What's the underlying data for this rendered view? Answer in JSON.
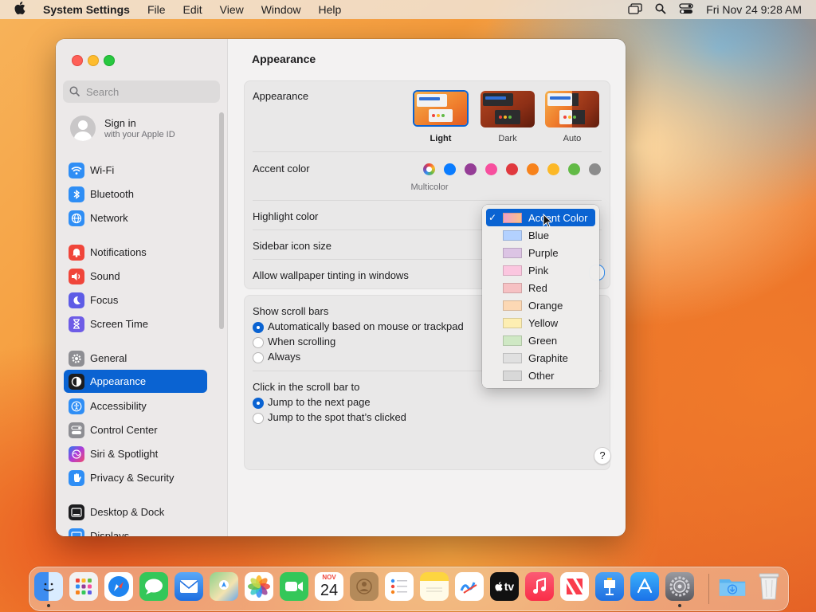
{
  "menubar": {
    "app_name": "System Settings",
    "items": [
      "File",
      "Edit",
      "View",
      "Window",
      "Help"
    ],
    "datetime": "Fri Nov 24  9:28 AM"
  },
  "sidebar": {
    "search_placeholder": "Search",
    "signin": {
      "title": "Sign in",
      "subtitle": "with your Apple ID"
    },
    "items": [
      {
        "label": "Wi-Fi",
        "icon": "wifi-icon",
        "color": "#2f8ef5"
      },
      {
        "label": "Bluetooth",
        "icon": "bluetooth-icon",
        "color": "#2f8ef5"
      },
      {
        "label": "Network",
        "icon": "globe-icon",
        "color": "#2f8ef5"
      },
      {
        "label": "Notifications",
        "icon": "bell-icon",
        "color": "#f0453a"
      },
      {
        "label": "Sound",
        "icon": "speaker-icon",
        "color": "#f0453a"
      },
      {
        "label": "Focus",
        "icon": "moon-icon",
        "color": "#5e5ce6"
      },
      {
        "label": "Screen Time",
        "icon": "hourglass-icon",
        "color": "#6e5ce6"
      },
      {
        "label": "General",
        "icon": "gear-icon",
        "color": "#8e8e93"
      },
      {
        "label": "Appearance",
        "icon": "appearance-icon",
        "color": "#1d1d1f"
      },
      {
        "label": "Accessibility",
        "icon": "accessibility-icon",
        "color": "#2f8ef5"
      },
      {
        "label": "Control Center",
        "icon": "control-center-icon",
        "color": "#8e8e93"
      },
      {
        "label": "Siri & Spotlight",
        "icon": "siri-icon",
        "color": "#7f3fbf"
      },
      {
        "label": "Privacy & Security",
        "icon": "hand-icon",
        "color": "#2f8ef5"
      },
      {
        "label": "Desktop & Dock",
        "icon": "dock-icon",
        "color": "#1d1d1f"
      },
      {
        "label": "Displays",
        "icon": "display-icon",
        "color": "#2f8ef5"
      }
    ]
  },
  "content": {
    "title": "Appearance",
    "appearance_label": "Appearance",
    "modes": [
      "Light",
      "Dark",
      "Auto"
    ],
    "accent_label": "Accent color",
    "accent_selected_name": "Multicolor",
    "accent_colors": [
      "#0a7cff",
      "#953d96",
      "#f74f9e",
      "#e0383e",
      "#f7821b",
      "#fcb827",
      "#62ba46",
      "#8c8c8c"
    ],
    "highlight_label": "Highlight color",
    "sidebar_icon_label": "Sidebar icon size",
    "tinting_label": "Allow wallpaper tinting in windows",
    "scroll_label": "Show scroll bars",
    "scroll_options": [
      "Automatically based on mouse or trackpad",
      "When scrolling",
      "Always"
    ],
    "click_label": "Click in the scroll bar to",
    "click_options": [
      "Jump to the next page",
      "Jump to the spot that’s clicked"
    ],
    "help": "?"
  },
  "highlight_menu": {
    "items": [
      {
        "label": "Accent Color",
        "swatch": "#e9a0c0",
        "selected": true
      },
      {
        "label": "Blue",
        "swatch": "#b3d1ff"
      },
      {
        "label": "Purple",
        "swatch": "#dcc4e4"
      },
      {
        "label": "Pink",
        "swatch": "#fbc6df"
      },
      {
        "label": "Red",
        "swatch": "#f6c1c3"
      },
      {
        "label": "Orange",
        "swatch": "#fcd8b4"
      },
      {
        "label": "Yellow",
        "swatch": "#fdeeb2"
      },
      {
        "label": "Green",
        "swatch": "#cfe8c4"
      },
      {
        "label": "Graphite",
        "swatch": "#e0e0e0"
      },
      {
        "label": "Other",
        "swatch": "#d8d8d8"
      }
    ]
  },
  "dock": {
    "calendar_month": "NOV",
    "calendar_day": "24",
    "tv_label": "tv",
    "apps": [
      {
        "name": "finder-icon",
        "color": "#3d8cf0"
      },
      {
        "name": "launchpad-icon",
        "color": "#f2f2f2"
      },
      {
        "name": "safari-icon",
        "color": "#1e84f0"
      },
      {
        "name": "messages-icon",
        "color": "#34c759"
      },
      {
        "name": "mail-icon",
        "color": "#3b8df5"
      },
      {
        "name": "maps-icon",
        "color": "#5fbf6a"
      },
      {
        "name": "photos-icon",
        "color": "#f8f8f8"
      },
      {
        "name": "facetime-icon",
        "color": "#34c759"
      },
      {
        "name": "calendar-icon",
        "color": "#ffffff"
      },
      {
        "name": "contacts-icon",
        "color": "#b48a5a"
      },
      {
        "name": "reminders-icon",
        "color": "#ffffff"
      },
      {
        "name": "notes-icon",
        "color": "#fdd540"
      },
      {
        "name": "freeform-icon",
        "color": "#ffffff"
      },
      {
        "name": "apple-tv-icon",
        "color": "#111111"
      },
      {
        "name": "music-icon",
        "color": "#fa3c4c"
      },
      {
        "name": "news-icon",
        "color": "#fa3c4c"
      },
      {
        "name": "keynote-icon",
        "color": "#2f8ef5"
      },
      {
        "name": "app-store-icon",
        "color": "#1b8cf5"
      },
      {
        "name": "system-settings-icon",
        "color": "#6e6e73"
      },
      {
        "name": "downloads-folder-icon",
        "color": "#5ab4f0"
      },
      {
        "name": "trash-icon",
        "color": "#e6e6e6"
      }
    ]
  }
}
